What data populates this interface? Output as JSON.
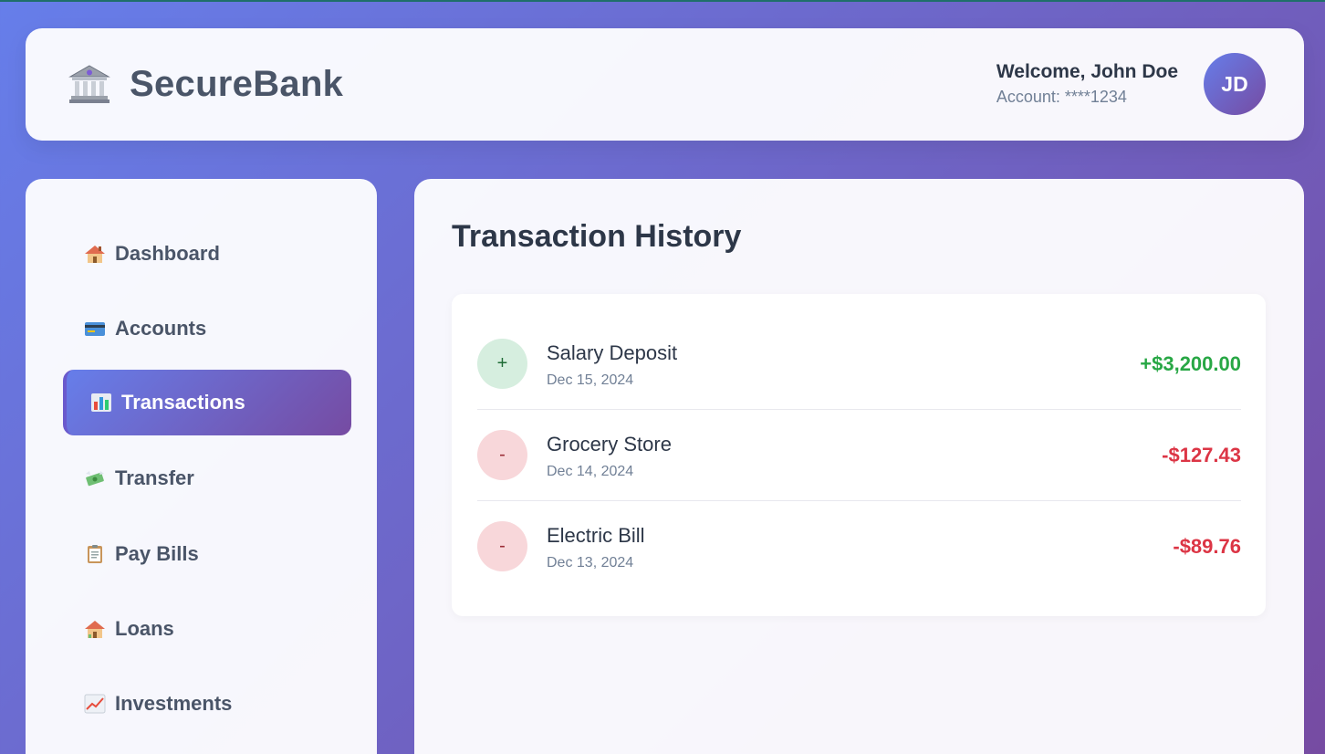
{
  "brand": {
    "name": "SecureBank",
    "icon": "bank-icon"
  },
  "user": {
    "welcome": "Welcome, John Doe",
    "account": "Account: ****1234",
    "initials": "JD"
  },
  "sidebar": {
    "items": [
      {
        "label": "Dashboard",
        "icon": "house-icon",
        "active": false
      },
      {
        "label": "Accounts",
        "icon": "credit-card-icon",
        "active": false
      },
      {
        "label": "Transactions",
        "icon": "bar-chart-icon",
        "active": true
      },
      {
        "label": "Transfer",
        "icon": "money-wings-icon",
        "active": false
      },
      {
        "label": "Pay Bills",
        "icon": "clipboard-icon",
        "active": false
      },
      {
        "label": "Loans",
        "icon": "house-icon",
        "active": false
      },
      {
        "label": "Investments",
        "icon": "chart-increasing-icon",
        "active": false
      }
    ]
  },
  "main": {
    "title": "Transaction History",
    "transactions": [
      {
        "sign": "+",
        "name": "Salary Deposit",
        "date": "Dec 15, 2024",
        "amount": "+$3,200.00",
        "type": "credit"
      },
      {
        "sign": "-",
        "name": "Grocery Store",
        "date": "Dec 14, 2024",
        "amount": "-$127.43",
        "type": "debit"
      },
      {
        "sign": "-",
        "name": "Electric Bill",
        "date": "Dec 13, 2024",
        "amount": "-$89.76",
        "type": "debit"
      }
    ]
  },
  "colors": {
    "gradient_start": "#667eea",
    "gradient_end": "#764ba2",
    "credit": "#28a745",
    "debit": "#dc3545"
  }
}
